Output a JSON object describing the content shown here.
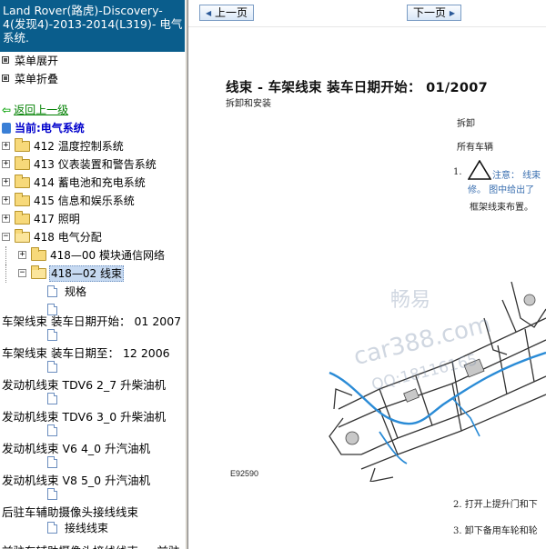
{
  "sidebar": {
    "title": "Land Rover(路虎)-Discovery-4(发现4)-2013-2014(L319)- 电气系统.",
    "expand_all": "菜单展开",
    "collapse_all": "菜单折叠",
    "back": "返回上一级",
    "current": "当前:电气系统",
    "tree": [
      {
        "label": "412 温度控制系统",
        "expanded": false
      },
      {
        "label": "413 仪表装置和警告系统",
        "expanded": false
      },
      {
        "label": "414 蓄电池和充电系统",
        "expanded": false
      },
      {
        "label": "415 信息和娱乐系统",
        "expanded": false
      },
      {
        "label": "417 照明",
        "expanded": false
      },
      {
        "label": "418 电气分配",
        "expanded": true
      }
    ],
    "subtree": [
      {
        "label": "418—00 模块通信网络",
        "expanded": false
      },
      {
        "label": "418—02 线束",
        "expanded": true,
        "selected": true
      }
    ],
    "leaves": [
      "规格",
      "",
      "车架线束 装车日期开始： 01 2007",
      "车架线束 装车日期至： 12 2006",
      "发动机线束 TDV6 2_7 升柴油机",
      "发动机线束 TDV6 3_0 升柴油机",
      "发动机线束 V6 4_0 升汽油机",
      "发动机线束 V8 5_0 升汽油机",
      "后驻车辅助摄像头接线线束",
      "接线线束",
      "前驻车辅助摄像头接线线束 — 前驻"
    ]
  },
  "nav": {
    "prev": "上一页",
    "next": "下一页"
  },
  "document": {
    "title": "线束 - 车架线束 装车日期开始： 01/2007",
    "subtitle": "拆卸和安装",
    "removal": "拆卸",
    "all_vehicles": "所有车辆",
    "step1_num": "1.",
    "step1_note": "注意： 线束",
    "step1_note2": "修。 图中给出了",
    "step1_text": "框架线束布置。",
    "figure_id": "E92590",
    "step2": "2. 打开上提升门和下",
    "step3": "3. 卸下备用车轮和轮"
  },
  "watermark": {
    "line1": "畅易",
    "line2": "car388.com",
    "line3": "QQ:18116165"
  }
}
